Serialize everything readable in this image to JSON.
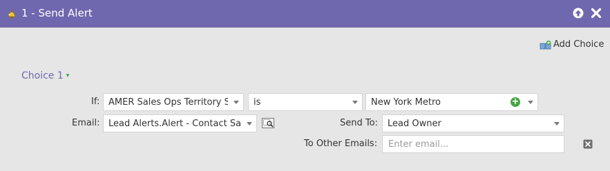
{
  "dialog": {
    "title": "1 - Send Alert",
    "icon": "alert-bell-icon",
    "collapse_icon": "arrow-up-icon",
    "close_icon": "close-icon"
  },
  "toolbar": {
    "add_choice_label": "Add Choice",
    "add_choice_icon": "add-choice-icon"
  },
  "choice": {
    "title": "Choice 1",
    "caret": "▾",
    "if_label": "If:",
    "if_attribute": "AMER Sales Ops Territory S",
    "if_operator": "is",
    "if_value": "New York Metro",
    "email_label": "Email:",
    "email_value": "Lead Alerts.Alert - Contact Sal",
    "send_to_label": "Send To:",
    "send_to_value": "Lead Owner",
    "other_emails_label": "To Other Emails:",
    "other_emails_placeholder": "Enter email...",
    "other_emails_value": ""
  },
  "colors": {
    "titlebar": "#7068ae",
    "background": "#e6e6e6",
    "accent_green": "#44a544",
    "choice_title": "#7068ae"
  }
}
